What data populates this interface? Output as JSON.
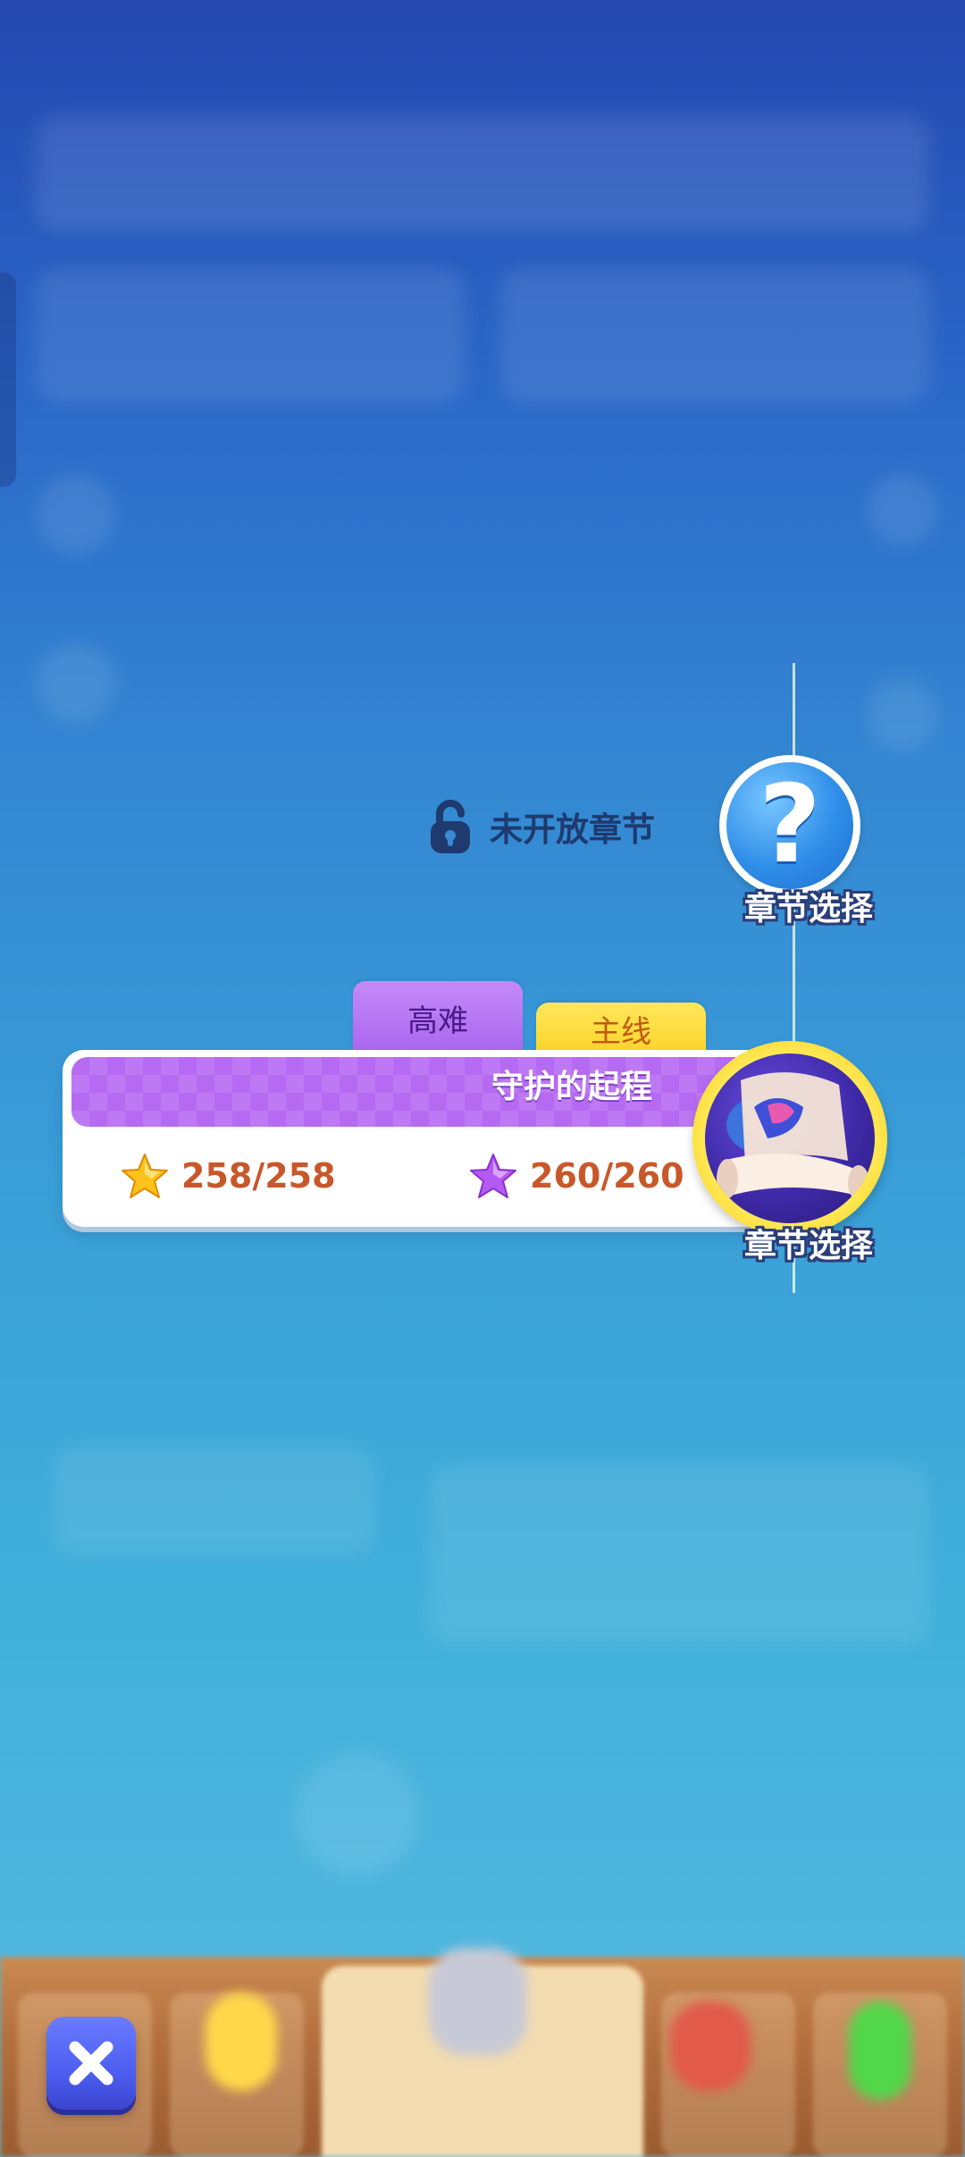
{
  "locked_chapter": {
    "label": "未开放章节"
  },
  "nodes": {
    "upcoming": {
      "mark": "?",
      "label": "章节选择"
    },
    "current": {
      "label": "章节选择"
    }
  },
  "tabs": {
    "hard": "高难",
    "main": "主线"
  },
  "chapter_card": {
    "title": "守护的起程",
    "gold_stars": "258/258",
    "purple_stars": "260/260"
  },
  "colors": {
    "accent_purple": "#b66af2",
    "tab_yellow": "#fbd42b",
    "stat_text": "#c8582a",
    "close_button": "#4d5ef0"
  },
  "icons": {
    "lock": "lock-icon",
    "gold_star": "gold-star-icon",
    "purple_star": "purple-star-icon",
    "close": "close-icon",
    "scroll": "scroll-icon"
  }
}
